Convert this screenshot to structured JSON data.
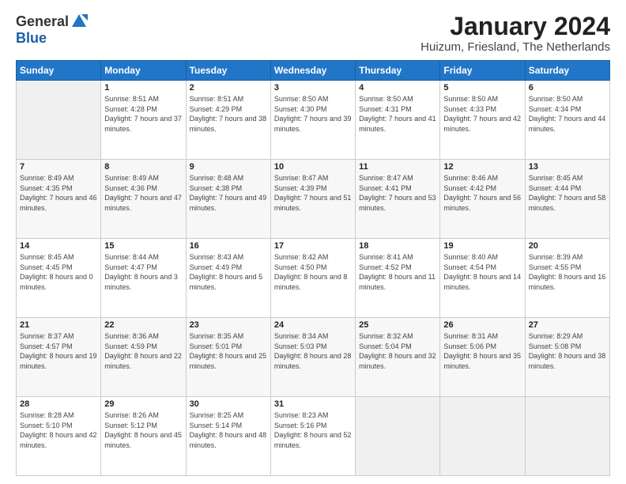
{
  "logo": {
    "general": "General",
    "blue": "Blue"
  },
  "title": "January 2024",
  "location": "Huizum, Friesland, The Netherlands",
  "days_of_week": [
    "Sunday",
    "Monday",
    "Tuesday",
    "Wednesday",
    "Thursday",
    "Friday",
    "Saturday"
  ],
  "weeks": [
    [
      {
        "day": "",
        "sunrise": "",
        "sunset": "",
        "daylight": ""
      },
      {
        "day": "1",
        "sunrise": "Sunrise: 8:51 AM",
        "sunset": "Sunset: 4:28 PM",
        "daylight": "Daylight: 7 hours and 37 minutes."
      },
      {
        "day": "2",
        "sunrise": "Sunrise: 8:51 AM",
        "sunset": "Sunset: 4:29 PM",
        "daylight": "Daylight: 7 hours and 38 minutes."
      },
      {
        "day": "3",
        "sunrise": "Sunrise: 8:50 AM",
        "sunset": "Sunset: 4:30 PM",
        "daylight": "Daylight: 7 hours and 39 minutes."
      },
      {
        "day": "4",
        "sunrise": "Sunrise: 8:50 AM",
        "sunset": "Sunset: 4:31 PM",
        "daylight": "Daylight: 7 hours and 41 minutes."
      },
      {
        "day": "5",
        "sunrise": "Sunrise: 8:50 AM",
        "sunset": "Sunset: 4:33 PM",
        "daylight": "Daylight: 7 hours and 42 minutes."
      },
      {
        "day": "6",
        "sunrise": "Sunrise: 8:50 AM",
        "sunset": "Sunset: 4:34 PM",
        "daylight": "Daylight: 7 hours and 44 minutes."
      }
    ],
    [
      {
        "day": "7",
        "sunrise": "Sunrise: 8:49 AM",
        "sunset": "Sunset: 4:35 PM",
        "daylight": "Daylight: 7 hours and 46 minutes."
      },
      {
        "day": "8",
        "sunrise": "Sunrise: 8:49 AM",
        "sunset": "Sunset: 4:36 PM",
        "daylight": "Daylight: 7 hours and 47 minutes."
      },
      {
        "day": "9",
        "sunrise": "Sunrise: 8:48 AM",
        "sunset": "Sunset: 4:38 PM",
        "daylight": "Daylight: 7 hours and 49 minutes."
      },
      {
        "day": "10",
        "sunrise": "Sunrise: 8:47 AM",
        "sunset": "Sunset: 4:39 PM",
        "daylight": "Daylight: 7 hours and 51 minutes."
      },
      {
        "day": "11",
        "sunrise": "Sunrise: 8:47 AM",
        "sunset": "Sunset: 4:41 PM",
        "daylight": "Daylight: 7 hours and 53 minutes."
      },
      {
        "day": "12",
        "sunrise": "Sunrise: 8:46 AM",
        "sunset": "Sunset: 4:42 PM",
        "daylight": "Daylight: 7 hours and 56 minutes."
      },
      {
        "day": "13",
        "sunrise": "Sunrise: 8:45 AM",
        "sunset": "Sunset: 4:44 PM",
        "daylight": "Daylight: 7 hours and 58 minutes."
      }
    ],
    [
      {
        "day": "14",
        "sunrise": "Sunrise: 8:45 AM",
        "sunset": "Sunset: 4:45 PM",
        "daylight": "Daylight: 8 hours and 0 minutes."
      },
      {
        "day": "15",
        "sunrise": "Sunrise: 8:44 AM",
        "sunset": "Sunset: 4:47 PM",
        "daylight": "Daylight: 8 hours and 3 minutes."
      },
      {
        "day": "16",
        "sunrise": "Sunrise: 8:43 AM",
        "sunset": "Sunset: 4:49 PM",
        "daylight": "Daylight: 8 hours and 5 minutes."
      },
      {
        "day": "17",
        "sunrise": "Sunrise: 8:42 AM",
        "sunset": "Sunset: 4:50 PM",
        "daylight": "Daylight: 8 hours and 8 minutes."
      },
      {
        "day": "18",
        "sunrise": "Sunrise: 8:41 AM",
        "sunset": "Sunset: 4:52 PM",
        "daylight": "Daylight: 8 hours and 11 minutes."
      },
      {
        "day": "19",
        "sunrise": "Sunrise: 8:40 AM",
        "sunset": "Sunset: 4:54 PM",
        "daylight": "Daylight: 8 hours and 14 minutes."
      },
      {
        "day": "20",
        "sunrise": "Sunrise: 8:39 AM",
        "sunset": "Sunset: 4:55 PM",
        "daylight": "Daylight: 8 hours and 16 minutes."
      }
    ],
    [
      {
        "day": "21",
        "sunrise": "Sunrise: 8:37 AM",
        "sunset": "Sunset: 4:57 PM",
        "daylight": "Daylight: 8 hours and 19 minutes."
      },
      {
        "day": "22",
        "sunrise": "Sunrise: 8:36 AM",
        "sunset": "Sunset: 4:59 PM",
        "daylight": "Daylight: 8 hours and 22 minutes."
      },
      {
        "day": "23",
        "sunrise": "Sunrise: 8:35 AM",
        "sunset": "Sunset: 5:01 PM",
        "daylight": "Daylight: 8 hours and 25 minutes."
      },
      {
        "day": "24",
        "sunrise": "Sunrise: 8:34 AM",
        "sunset": "Sunset: 5:03 PM",
        "daylight": "Daylight: 8 hours and 28 minutes."
      },
      {
        "day": "25",
        "sunrise": "Sunrise: 8:32 AM",
        "sunset": "Sunset: 5:04 PM",
        "daylight": "Daylight: 8 hours and 32 minutes."
      },
      {
        "day": "26",
        "sunrise": "Sunrise: 8:31 AM",
        "sunset": "Sunset: 5:06 PM",
        "daylight": "Daylight: 8 hours and 35 minutes."
      },
      {
        "day": "27",
        "sunrise": "Sunrise: 8:29 AM",
        "sunset": "Sunset: 5:08 PM",
        "daylight": "Daylight: 8 hours and 38 minutes."
      }
    ],
    [
      {
        "day": "28",
        "sunrise": "Sunrise: 8:28 AM",
        "sunset": "Sunset: 5:10 PM",
        "daylight": "Daylight: 8 hours and 42 minutes."
      },
      {
        "day": "29",
        "sunrise": "Sunrise: 8:26 AM",
        "sunset": "Sunset: 5:12 PM",
        "daylight": "Daylight: 8 hours and 45 minutes."
      },
      {
        "day": "30",
        "sunrise": "Sunrise: 8:25 AM",
        "sunset": "Sunset: 5:14 PM",
        "daylight": "Daylight: 8 hours and 48 minutes."
      },
      {
        "day": "31",
        "sunrise": "Sunrise: 8:23 AM",
        "sunset": "Sunset: 5:16 PM",
        "daylight": "Daylight: 8 hours and 52 minutes."
      },
      {
        "day": "",
        "sunrise": "",
        "sunset": "",
        "daylight": ""
      },
      {
        "day": "",
        "sunrise": "",
        "sunset": "",
        "daylight": ""
      },
      {
        "day": "",
        "sunrise": "",
        "sunset": "",
        "daylight": ""
      }
    ]
  ]
}
